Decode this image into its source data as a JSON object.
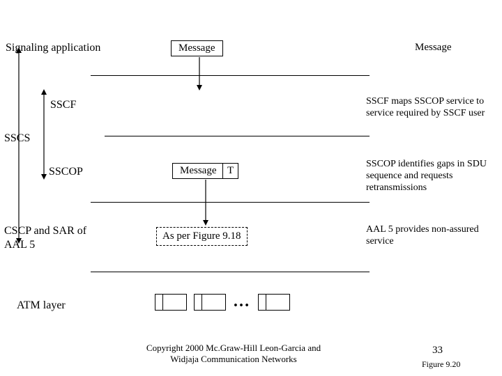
{
  "diagram": {
    "signaling_app": "Signaling application",
    "right_message_top": "Message",
    "msg_box_top": "Message",
    "sscf": "SSCF",
    "sscs": "SSCS",
    "sscop": "SSCOP",
    "msg_box_mid": "Message",
    "trailer": "T",
    "cscp_sar": "CSCP and SAR of\nAAL 5",
    "aal_box": "As per Figure 9.18",
    "atm_layer": "ATM layer",
    "note_sscf": "SSCF maps SSCOP service to service required by SSCF user",
    "note_sscop": "SSCOP identifies gaps in SDU sequence and requests retransmissions",
    "note_aal": "AAL 5 provides non-assured service"
  },
  "footer": {
    "copyright": "Copyright 2000 Mc.Graw-Hill  Leon-Garcia and Widjaja  Communication Networks",
    "page": "33",
    "figref": "Figure 9.20"
  }
}
